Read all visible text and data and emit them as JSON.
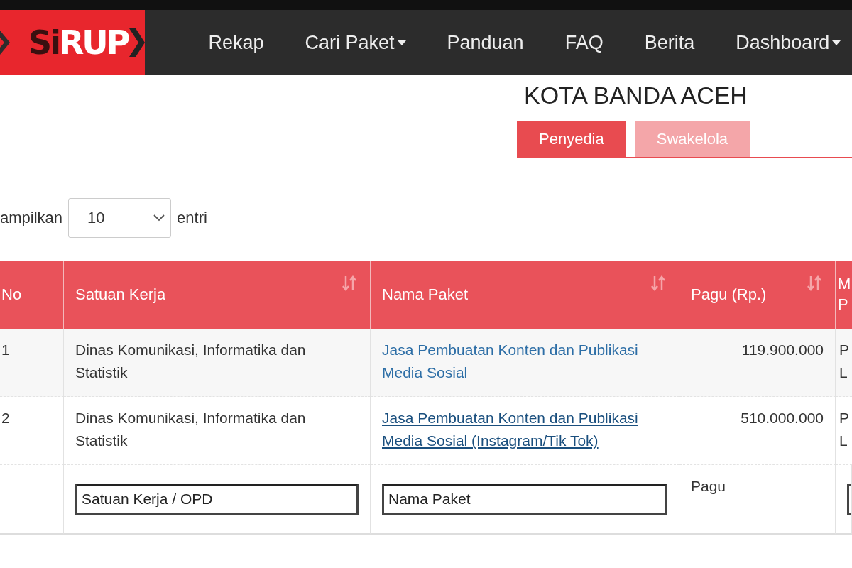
{
  "navbar": {
    "logo": [
      "Si",
      "RUP"
    ],
    "items": [
      {
        "label": "Rekap",
        "dropdown": false
      },
      {
        "label": "Cari Paket",
        "dropdown": true
      },
      {
        "label": "Panduan",
        "dropdown": false
      },
      {
        "label": "FAQ",
        "dropdown": false
      },
      {
        "label": "Berita",
        "dropdown": false
      },
      {
        "label": "Dashboard",
        "dropdown": true
      }
    ]
  },
  "page_title": "KOTA BANDA ACEH",
  "tabs": [
    {
      "label": "Penyedia",
      "selected": true
    },
    {
      "label": "Swakelola",
      "selected": false
    }
  ],
  "length_control": {
    "label_before": "ampilkan",
    "value": "10",
    "label_after": "entri"
  },
  "table": {
    "columns": [
      {
        "label": "No",
        "sortable": false
      },
      {
        "label": "Satuan Kerja",
        "sortable": true
      },
      {
        "label": "Nama Paket",
        "sortable": true
      },
      {
        "label": "Pagu (Rp.)",
        "sortable": true
      },
      {
        "label": "M\nP",
        "sortable": false
      }
    ],
    "rows": [
      {
        "no": "1",
        "satuan_kerja": "Dinas Komunikasi, Informatika dan Statistik",
        "nama_paket": "Jasa Pembuatan Konten dan Publikasi Media Sosial",
        "hovered": false,
        "pagu": "119.900.000",
        "column_5": "P\nL"
      },
      {
        "no": "2",
        "satuan_kerja": "Dinas Komunikasi, Informatika dan Statistik",
        "nama_paket": "Jasa Pembuatan Konten dan Publikasi Media Sosial (Instagram/Tik Tok)",
        "hovered": true,
        "pagu": "510.000.000",
        "column_5": "P\nL"
      }
    ],
    "filters": {
      "satuan_kerja": {
        "placeholder": "Satuan Kerja / OPD"
      },
      "nama_paket": {
        "placeholder": "Nama Paket"
      },
      "pagu_label": "Pagu"
    }
  }
}
